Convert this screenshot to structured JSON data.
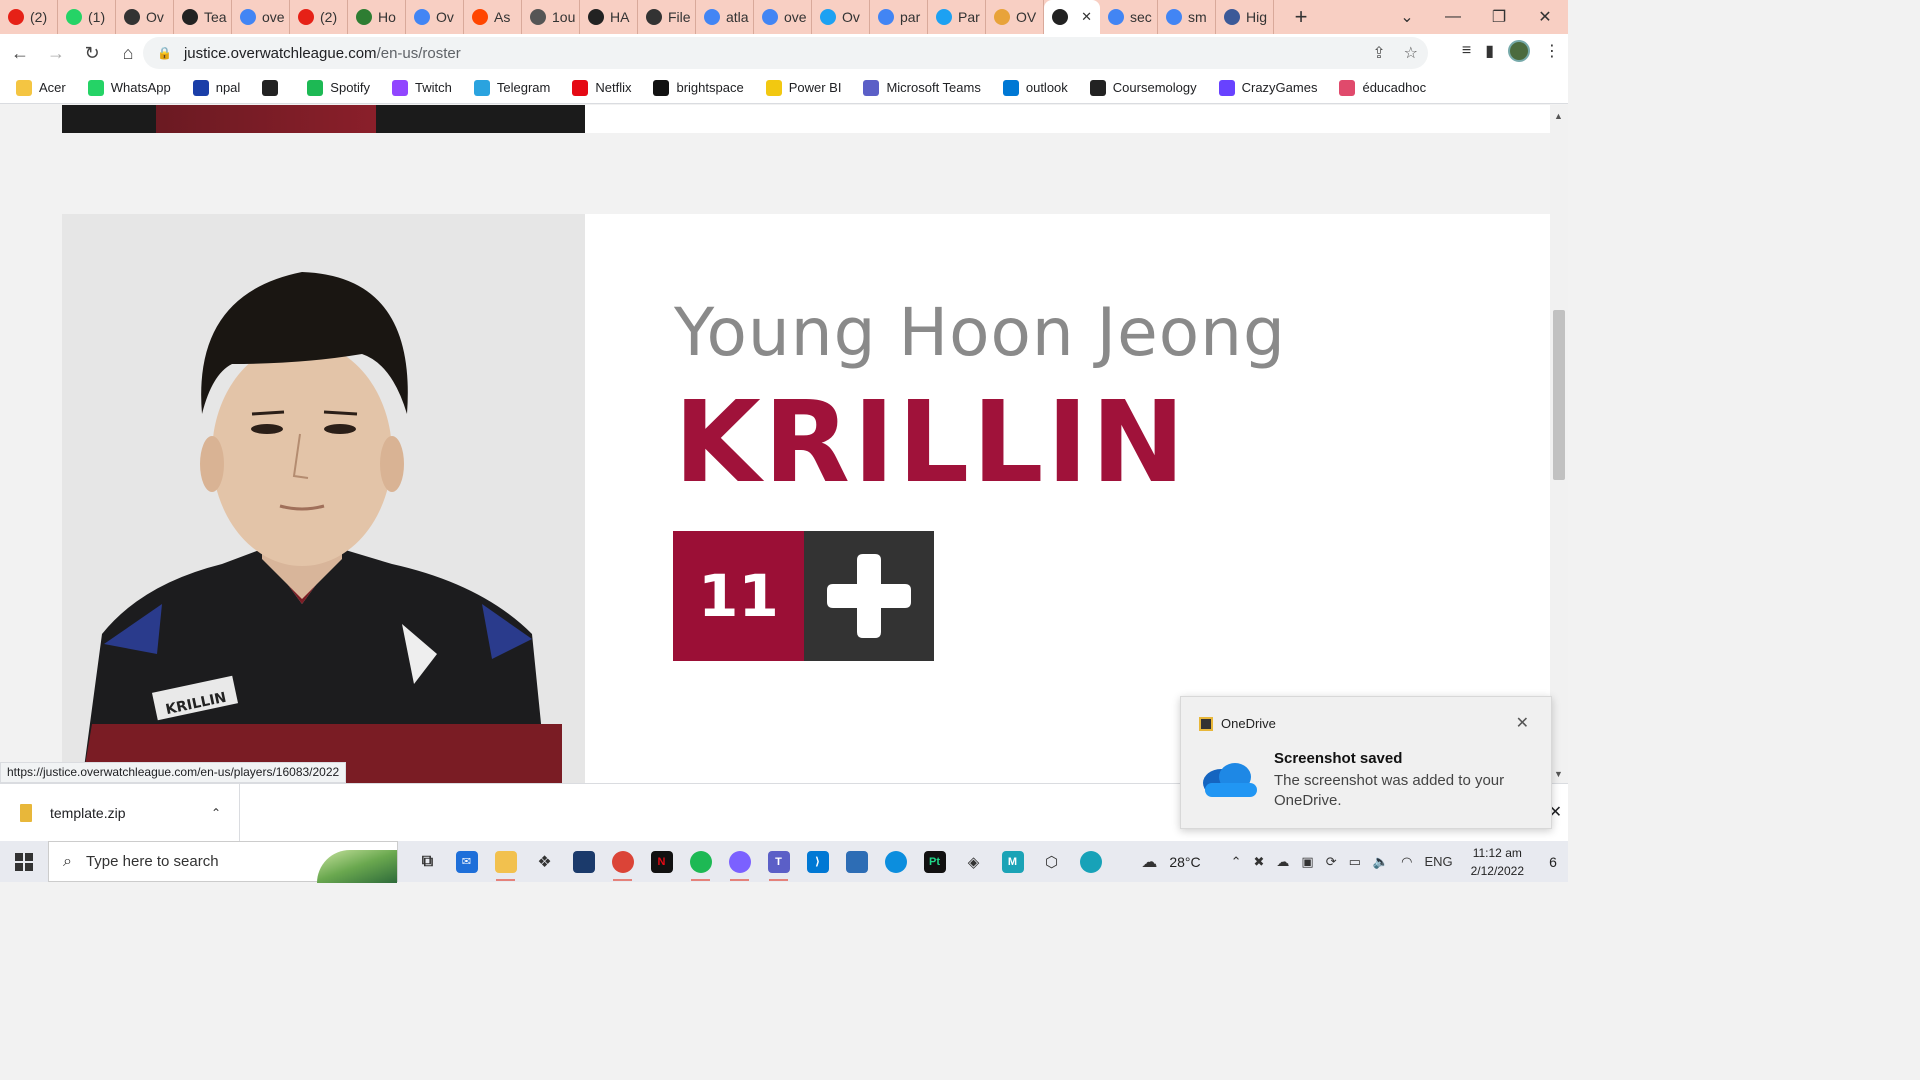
{
  "browser": {
    "tabs": [
      {
        "label": "(2)",
        "icon": "youtube-icon",
        "color": "#e62117"
      },
      {
        "label": "(1)",
        "icon": "whatsapp-icon",
        "color": "#25d366"
      },
      {
        "label": "Ov",
        "icon": "overwatch-icon",
        "color": "#333333"
      },
      {
        "label": "Tea",
        "icon": "owl-icon",
        "color": "#222222"
      },
      {
        "label": "ove",
        "icon": "google-icon",
        "color": "#4285f4"
      },
      {
        "label": "(2)",
        "icon": "youtube-icon",
        "color": "#e62117"
      },
      {
        "label": "Ho",
        "icon": "wikihow-icon",
        "color": "#2e7d32"
      },
      {
        "label": "Ov",
        "icon": "google-icon",
        "color": "#4285f4"
      },
      {
        "label": "As",
        "icon": "reddit-icon",
        "color": "#ff4500"
      },
      {
        "label": "1ou",
        "icon": "globe-icon",
        "color": "#555555"
      },
      {
        "label": "HA",
        "icon": "owl-icon",
        "color": "#222222"
      },
      {
        "label": "File",
        "icon": "file-icon",
        "color": "#333333"
      },
      {
        "label": "atla",
        "icon": "google-icon",
        "color": "#4285f4"
      },
      {
        "label": "ove",
        "icon": "google-icon",
        "color": "#4285f4"
      },
      {
        "label": "Ov",
        "icon": "twitter-icon",
        "color": "#1da1f2"
      },
      {
        "label": "par",
        "icon": "google-icon",
        "color": "#4285f4"
      },
      {
        "label": "Par",
        "icon": "twitter-icon",
        "color": "#1da1f2"
      },
      {
        "label": "OV",
        "icon": "coin-icon",
        "color": "#e8a33a"
      },
      {
        "label": "",
        "icon": "owl-icon",
        "color": "#222222",
        "active": true
      },
      {
        "label": "sec",
        "icon": "google-icon",
        "color": "#4285f4"
      },
      {
        "label": "sm",
        "icon": "google-icon",
        "color": "#4285f4"
      },
      {
        "label": "Hig",
        "icon": "globe-icon",
        "color": "#3b5998"
      }
    ],
    "address": {
      "host": "justice.overwatchleague.com",
      "path": "/en-us/roster"
    },
    "bookmarks": [
      {
        "label": "Acer",
        "icon": "folder-icon",
        "color": "#f4c542"
      },
      {
        "label": "WhatsApp",
        "icon": "whatsapp-icon",
        "color": "#25d366"
      },
      {
        "label": "npal",
        "icon": "npal-icon",
        "color": "#1a3ea8"
      },
      {
        "label": "",
        "icon": "globe-icon",
        "color": "#222222"
      },
      {
        "label": "Spotify",
        "icon": "spotify-icon",
        "color": "#1db954"
      },
      {
        "label": "Twitch",
        "icon": "twitch-icon",
        "color": "#9146ff"
      },
      {
        "label": "Telegram",
        "icon": "telegram-icon",
        "color": "#2aa3df"
      },
      {
        "label": "Netflix",
        "icon": "netflix-icon",
        "color": "#e50914"
      },
      {
        "label": "brightspace",
        "icon": "np-icon",
        "color": "#111111"
      },
      {
        "label": "Power BI",
        "icon": "powerbi-icon",
        "color": "#f2c811"
      },
      {
        "label": "Microsoft Teams",
        "icon": "teams-icon",
        "color": "#5b5fc7"
      },
      {
        "label": "outlook",
        "icon": "outlook-icon",
        "color": "#0078d4"
      },
      {
        "label": "Coursemology",
        "icon": "coursemology-icon",
        "color": "#222222"
      },
      {
        "label": "CrazyGames",
        "icon": "crazygames-icon",
        "color": "#6842ff"
      },
      {
        "label": "éducadhoc",
        "icon": "educadhoc-icon",
        "color": "#e04a6c"
      }
    ],
    "status_url": "https://justice.overwatchleague.com/en-us/players/16083/2022"
  },
  "player": {
    "name": "Young Hoon Jeong",
    "tag": "KRILLIN",
    "number": "11",
    "role_icon": "support-plus-icon",
    "jersey_text": "KRILLIN",
    "accent": "#9b0f36"
  },
  "downloads": {
    "file": "template.zip"
  },
  "toast": {
    "app": "OneDrive",
    "title": "Screenshot saved",
    "message": "The screenshot was added to your OneDrive."
  },
  "taskbar": {
    "search_placeholder": "Type here to search",
    "temperature": "28°C",
    "language": "ENG",
    "time": "11:12 am",
    "date": "2/12/2022",
    "notification_count": "6"
  }
}
